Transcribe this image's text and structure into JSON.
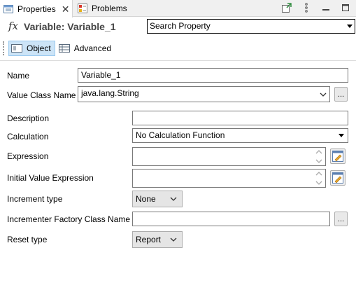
{
  "tabs": {
    "properties_label": "Properties",
    "problems_label": "Problems"
  },
  "header": {
    "fx_symbol": "fx",
    "title": "Variable: Variable_1",
    "search_value": "Search Property"
  },
  "toolbar": {
    "object_label": "Object",
    "advanced_label": "Advanced"
  },
  "form": {
    "name_label": "Name",
    "name_value": "Variable_1",
    "value_class_label": "Value Class Name",
    "value_class_value": "java.lang.String",
    "browse_label": "...",
    "description_label": "Description",
    "description_value": "",
    "calculation_label": "Calculation",
    "calculation_value": "No Calculation Function",
    "expression_label": "Expression",
    "initial_value_label": "Initial Value Expression",
    "increment_type_label": "Increment type",
    "increment_type_value": "None",
    "incrementer_label": "Incrementer Factory Class Name",
    "incrementer_browse": "...",
    "reset_type_label": "Reset type",
    "reset_type_value": "Report"
  }
}
